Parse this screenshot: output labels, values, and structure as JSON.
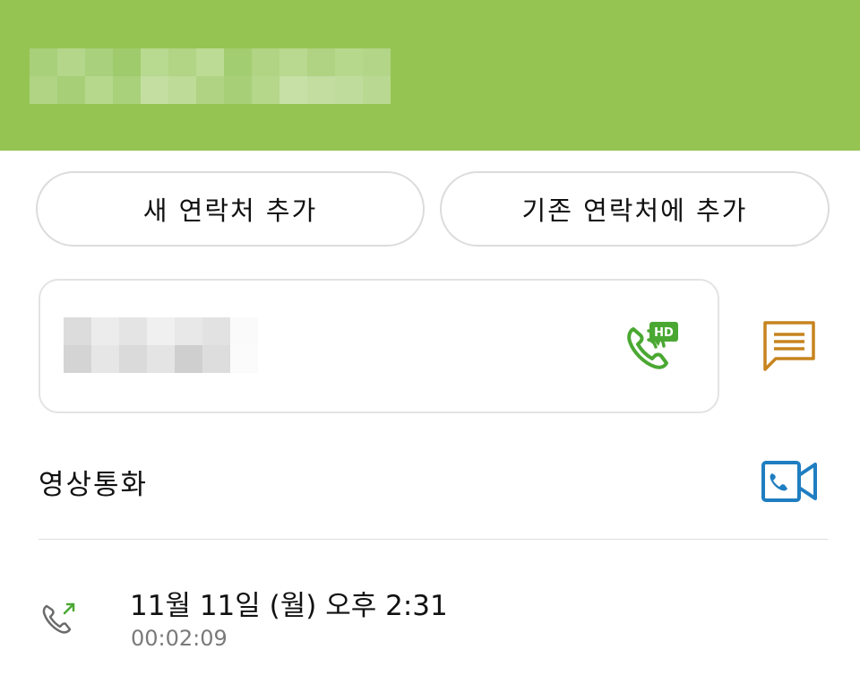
{
  "header": {
    "contact_name_redacted": true,
    "background_color": "#96c452"
  },
  "actions": {
    "add_new_contact_label": "새 연락처 추가",
    "add_to_existing_label": "기존 연락처에 추가"
  },
  "number_card": {
    "number_redacted": true,
    "hd_call_icon": "hd-voice-call-icon",
    "hd_badge_text": "HD",
    "message_icon": "message-icon"
  },
  "video_call": {
    "label": "영상통화",
    "icon": "video-call-icon"
  },
  "call_log": [
    {
      "icon": "outgoing-call-icon",
      "date": "11월 11일 (월) 오후 2:31",
      "duration": "00:02:09"
    }
  ],
  "colors": {
    "accent_green": "#4aa832",
    "message_orange": "#c7841e",
    "video_blue": "#1f7ec1"
  }
}
